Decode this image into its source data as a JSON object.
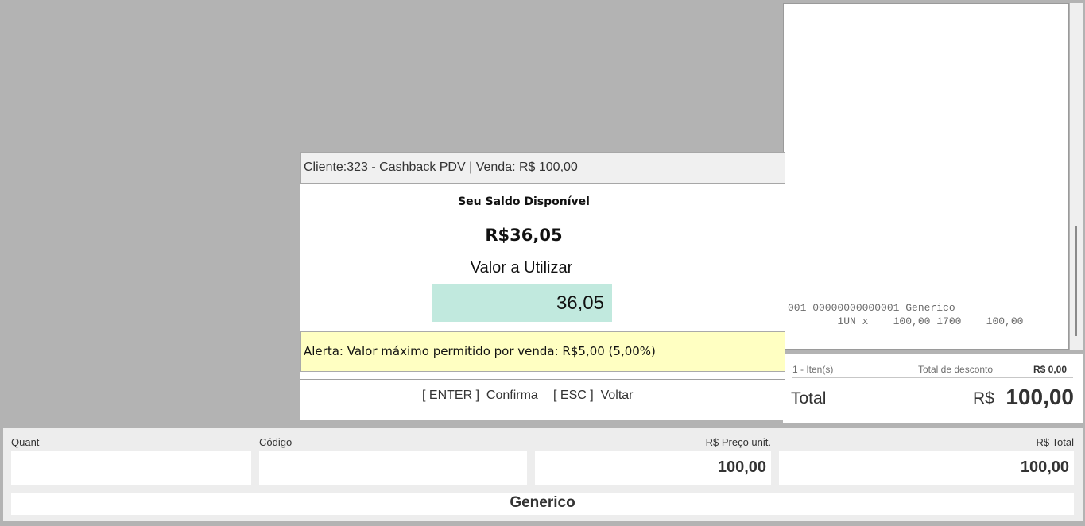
{
  "receipt": {
    "line1": "001 00000000000001 Generico",
    "line2": "        1UN x    100,00 1700    100,00"
  },
  "totals": {
    "items_count": "1 - Iten(s)",
    "discount_label": "Total de desconto",
    "discount_value": "R$ 0,00",
    "total_label": "Total",
    "currency": "R$",
    "total_value": "100,00"
  },
  "dialog": {
    "title": "Cliente:323 - Cashback PDV | Venda: R$ 100,00",
    "balance_label": "Seu Saldo Disponível",
    "balance_value": "R$36,05",
    "use_label": "Valor a Utilizar",
    "use_value": "36,05",
    "alert": "Alerta: Valor máximo permitido por venda: R$5,00 (5,00%)",
    "enter_key": "[ ENTER ]",
    "enter_label": "Confirma",
    "esc_key": "[ ESC ]",
    "esc_label": "Voltar"
  },
  "fields": {
    "quant_label": "Quant",
    "quant_value": "",
    "code_label": "Código",
    "code_value": "",
    "unit_price_label": "R$ Preço unit.",
    "unit_price_value": "100,00",
    "total_label": "R$ Total",
    "total_value": "100,00"
  },
  "product_name": "Generico"
}
